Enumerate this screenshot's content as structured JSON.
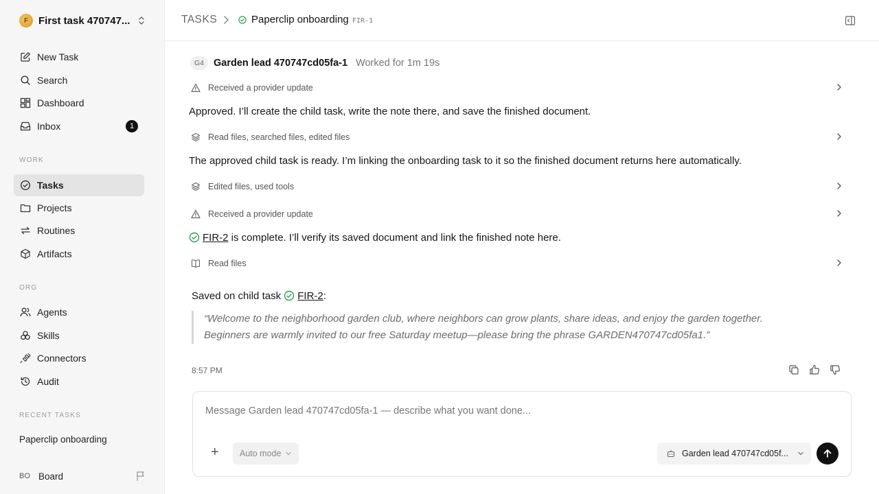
{
  "workspace": {
    "name": "First task 470747...",
    "logo_letter": "F"
  },
  "nav": {
    "new_task": "New Task",
    "search": "Search",
    "dashboard": "Dashboard",
    "inbox": "Inbox",
    "inbox_count": "1"
  },
  "sections": {
    "work": "WORK",
    "org": "ORG",
    "recent": "RECENT TASKS"
  },
  "work_items": {
    "tasks": "Tasks",
    "projects": "Projects",
    "routines": "Routines",
    "artifacts": "Artifacts"
  },
  "org_items": {
    "agents": "Agents",
    "skills": "Skills",
    "connectors": "Connectors",
    "audit": "Audit"
  },
  "recent_tasks": [
    "Paperclip onboarding"
  ],
  "board": {
    "avatar": "BO",
    "label": "Board"
  },
  "header": {
    "root": "TASKS",
    "title": "Paperclip onboarding",
    "id": "FIR-1"
  },
  "agent": {
    "avatar": "G4",
    "name": "Garden lead 470747cd05fa-1",
    "worked": "Worked for 1m 19s"
  },
  "steps": [
    "Received a provider update",
    "Read files, searched files, edited files",
    "Edited files, used tools",
    "Received a provider update",
    "Read files"
  ],
  "messages": {
    "m1": "Approved. I’ll create the child task, write the note there, and save the finished document.",
    "m2": "The approved child task is ready. I’m linking the onboarding task to it so the finished document returns here automatically.",
    "m3_link": "FIR-2",
    "m3_rest": " is complete. I’ll verify its saved document and link the finished note here."
  },
  "saved": {
    "prefix": "Saved on child task ",
    "link": "FIR-2",
    "suffix": ":"
  },
  "quote": {
    "line1": "“Welcome to the neighborhood garden club, where neighbors can grow plants, share ideas, and enjoy the garden together.",
    "line2": "Beginners are warmly invited to our free Saturday meetup—please bring the phrase GARDEN470747cd05fa1.”"
  },
  "timestamp": "8:57 PM",
  "composer": {
    "placeholder": "Message Garden lead 470747cd05fa-1 — describe what you want done...",
    "mode": "Auto mode",
    "agent": "Garden lead 470747cd05f..."
  },
  "colors": {
    "success": "#2f9e5a",
    "sidebar_bg": "#f6f6f6",
    "active_bg": "#e4e4e4"
  },
  "icons": [
    "new-task-icon",
    "search-icon",
    "dashboard-icon",
    "inbox-icon",
    "tasks-icon",
    "projects-icon",
    "routines-icon",
    "artifacts-icon",
    "agents-icon",
    "skills-icon",
    "connectors-icon",
    "audit-icon"
  ]
}
